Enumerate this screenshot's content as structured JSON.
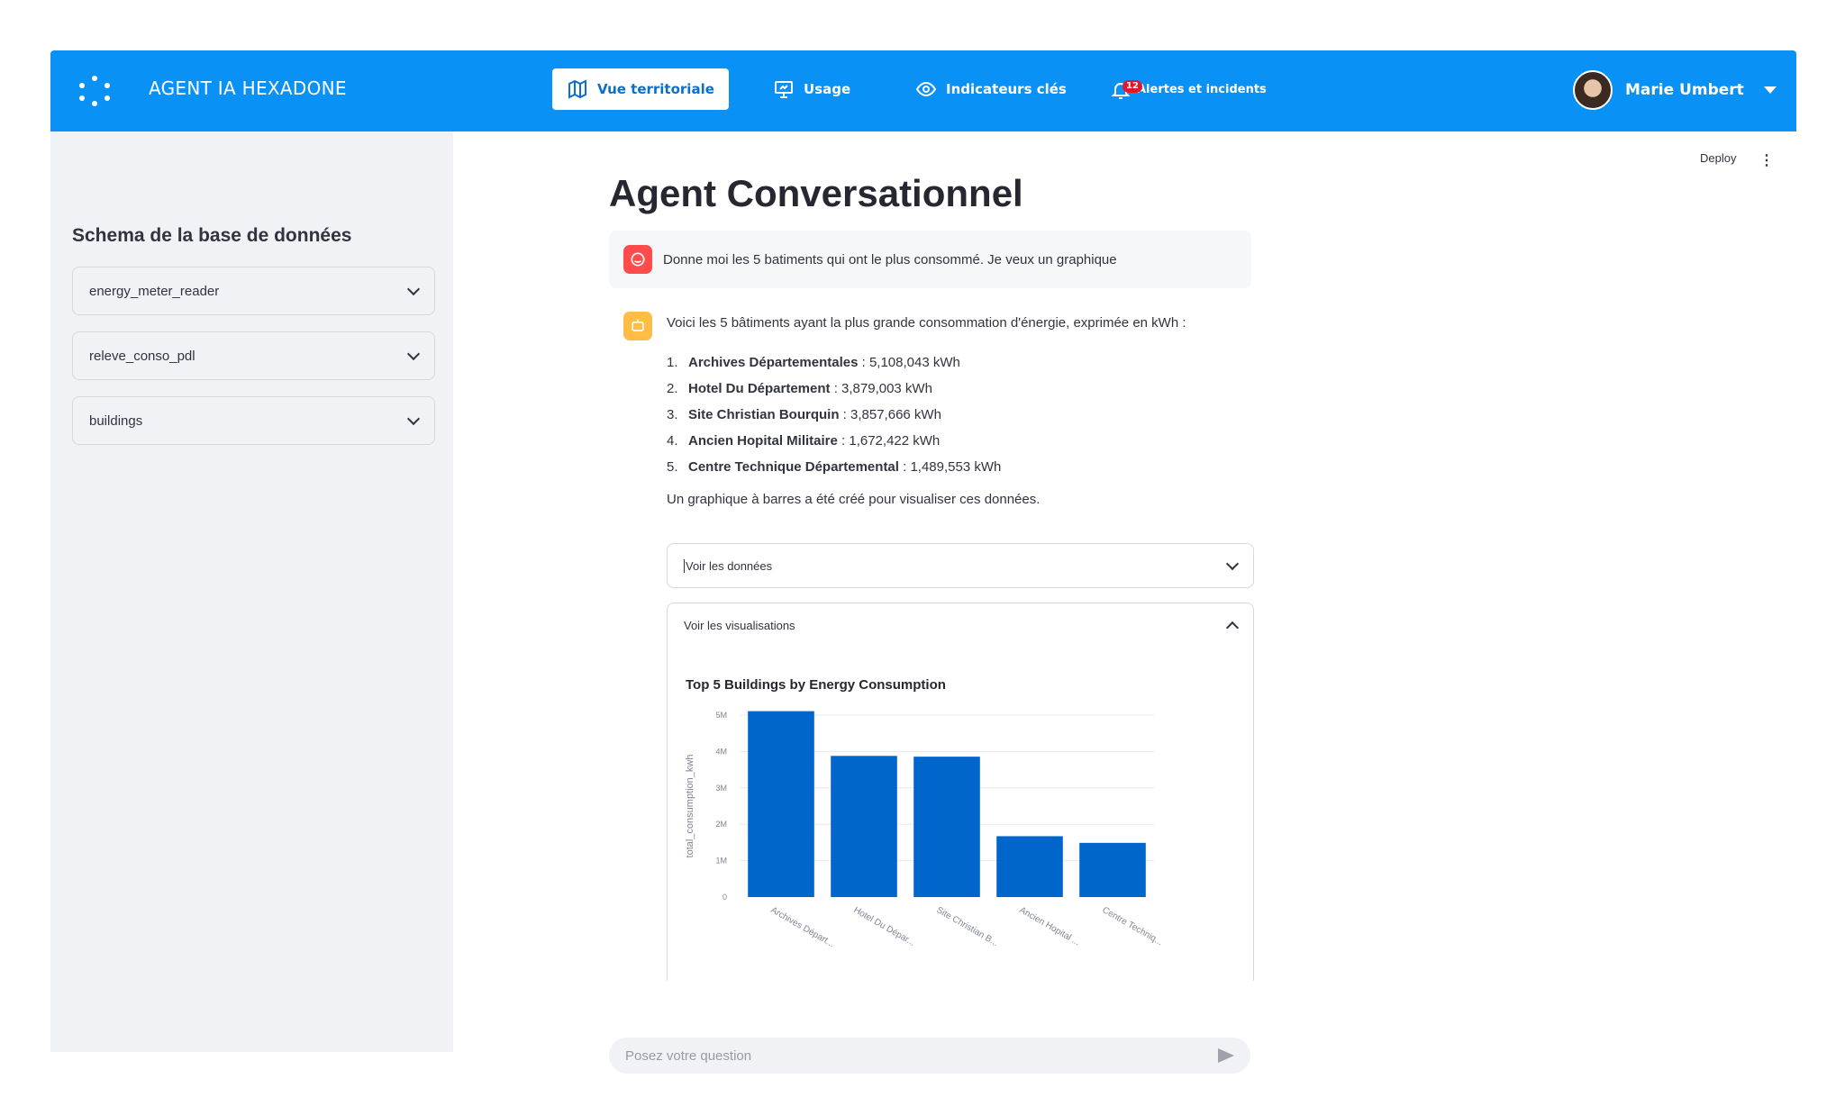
{
  "header": {
    "brand": "AGENT IA HEXADONE",
    "nav": [
      {
        "label": "Vue territoriale",
        "icon": "map-icon"
      },
      {
        "label": "Usage",
        "icon": "presentation-icon"
      },
      {
        "label": "Indicateurs clés",
        "icon": "eye-icon"
      },
      {
        "label": "Alertes et incidents",
        "icon": "bell-icon",
        "badge": "12"
      }
    ],
    "user_name": "Marie Umbert"
  },
  "toolbar": {
    "deploy": "Deploy",
    "menu": "⋮"
  },
  "sidebar": {
    "title": "Schema de la base de données",
    "tables": [
      "energy_meter_reader",
      "releve_conso_pdl",
      "buildings"
    ]
  },
  "main": {
    "title": "Agent Conversationnel",
    "user_message": "Donne moi les 5 batiments qui ont le plus consommé. Je veux un graphique",
    "bot_intro": "Voici les 5 bâtiments ayant la plus grande consommation d'énergie, exprimée en kWh :",
    "bot_list": [
      {
        "num": "1.",
        "name": "Archives Départementales",
        "value": " : 5,108,043 kWh"
      },
      {
        "num": "2.",
        "name": "Hotel Du Département",
        "value": " : 3,879,003 kWh"
      },
      {
        "num": "3.",
        "name": "Site Christian Bourquin",
        "value": " : 3,857,666 kWh"
      },
      {
        "num": "4.",
        "name": "Ancien Hopital Militaire",
        "value": " : 1,672,422 kWh"
      },
      {
        "num": "5.",
        "name": "Centre Technique Départemental",
        "value": " : 1,489,553 kWh"
      }
    ],
    "bot_outro": "Un graphique à barres a été créé pour visualiser ces données.",
    "expander_data": "Voir les données",
    "expander_viz": "Voir les visualisations",
    "chat_placeholder": "Posez votre question"
  },
  "chart_data": {
    "type": "bar",
    "title": "Top 5 Buildings by Energy Consumption",
    "xlabel": "",
    "ylabel": "total_consumption_kwh",
    "categories": [
      "Archives Départ...",
      "Hotel Du Dépar...",
      "Site Christian B...",
      "Ancien Hopital ...",
      "Centre Techniq..."
    ],
    "values": [
      5108043,
      3879003,
      3857666,
      1672422,
      1489553
    ],
    "ylim": [
      0,
      5000000
    ],
    "yticks": [
      0,
      1000000,
      2000000,
      3000000,
      4000000,
      5000000
    ],
    "ytick_labels": [
      "0",
      "1M",
      "2M",
      "3M",
      "4M",
      "5M"
    ],
    "grid": true,
    "bar_color": "#0066cc"
  },
  "colors": {
    "accent": "#0a91f5",
    "sidebar_bg": "#f0f2f6",
    "alert_badge": "#e0182d"
  }
}
